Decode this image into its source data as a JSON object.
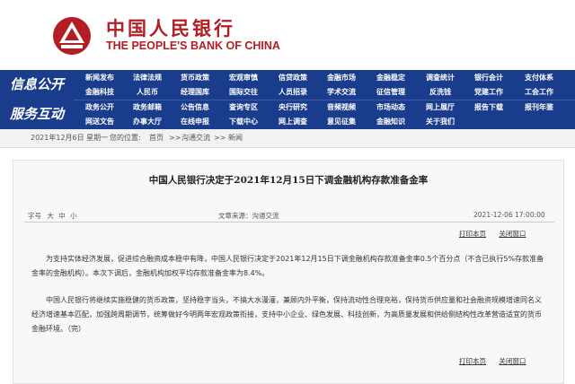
{
  "header": {
    "bank_name_cn": "中国人民银行",
    "bank_name_en": "THE PEOPLE'S BANK OF CHINA",
    "brand_color": "#b21e23",
    "logo_icon": "pboc-emblem-icon"
  },
  "nav": {
    "label_info": "信息公开",
    "label_service": "服务互动",
    "row1": [
      "新闻发布",
      "法律法规",
      "货币政策",
      "宏观审慎",
      "信贷政策",
      "金融市场",
      "金融稳定",
      "调查统计",
      "银行会计",
      "支付体系"
    ],
    "row2": [
      "金融科技",
      "人民币",
      "经理国库",
      "国际交往",
      "人员招录",
      "学术交流",
      "征信管理",
      "反洗钱",
      "党建工作",
      "工会工作"
    ],
    "row3": [
      "政务公开",
      "政务邮箱",
      "公告信息",
      "查询专区",
      "央行研究",
      "音频视频",
      "市场动态",
      "网上展厅",
      "报告下载",
      "报刊年鉴"
    ],
    "row4": [
      "网送文告",
      "办事大厅",
      "在线申报",
      "下载中心",
      "网上调查",
      "意见征集",
      "金融知识",
      "关于我们"
    ],
    "bar_color": "#1a3c8c"
  },
  "breadcrumb": {
    "date": "2021年12月6日 星期一",
    "location_label": "您的位置:",
    "home": "首页",
    "sep": ">>",
    "section": "沟通交流",
    "current": "新闻"
  },
  "article": {
    "title": "中国人民银行决定于2021年12月15日下调金融机构存款准备金率",
    "font_size_label": "字号",
    "font_large": "大",
    "font_medium": "中",
    "font_small": "小",
    "source": "文章来源：沟通交流",
    "datetime": "2021-12-06  17:00:00",
    "print_label": "打印本页",
    "close_label": "关闭窗口",
    "para1": "为支持实体经济发展，促进综合融资成本稳中有降，中国人民银行决定于2021年12月15日下调金融机构存款准备金率0.5个百分点（不含已执行5%存款准备金率的金融机构）。本次下调后，金融机构加权平均存款准备金率为8.4%。",
    "para2": "中国人民银行将继续实施稳健的货币政策，坚持稳字当头，不搞大水漫灌，兼顾内外平衡，保持流动性合理充裕，保持货币供应量和社会融资规模增速同名义经济增速基本匹配，加强跨周期调节，统筹做好今明两年宏观政策衔接，支持中小企业、绿色发展、科技创新，为高质量发展和供给侧结构性改革营造适宜的货币金融环境。（完）"
  }
}
